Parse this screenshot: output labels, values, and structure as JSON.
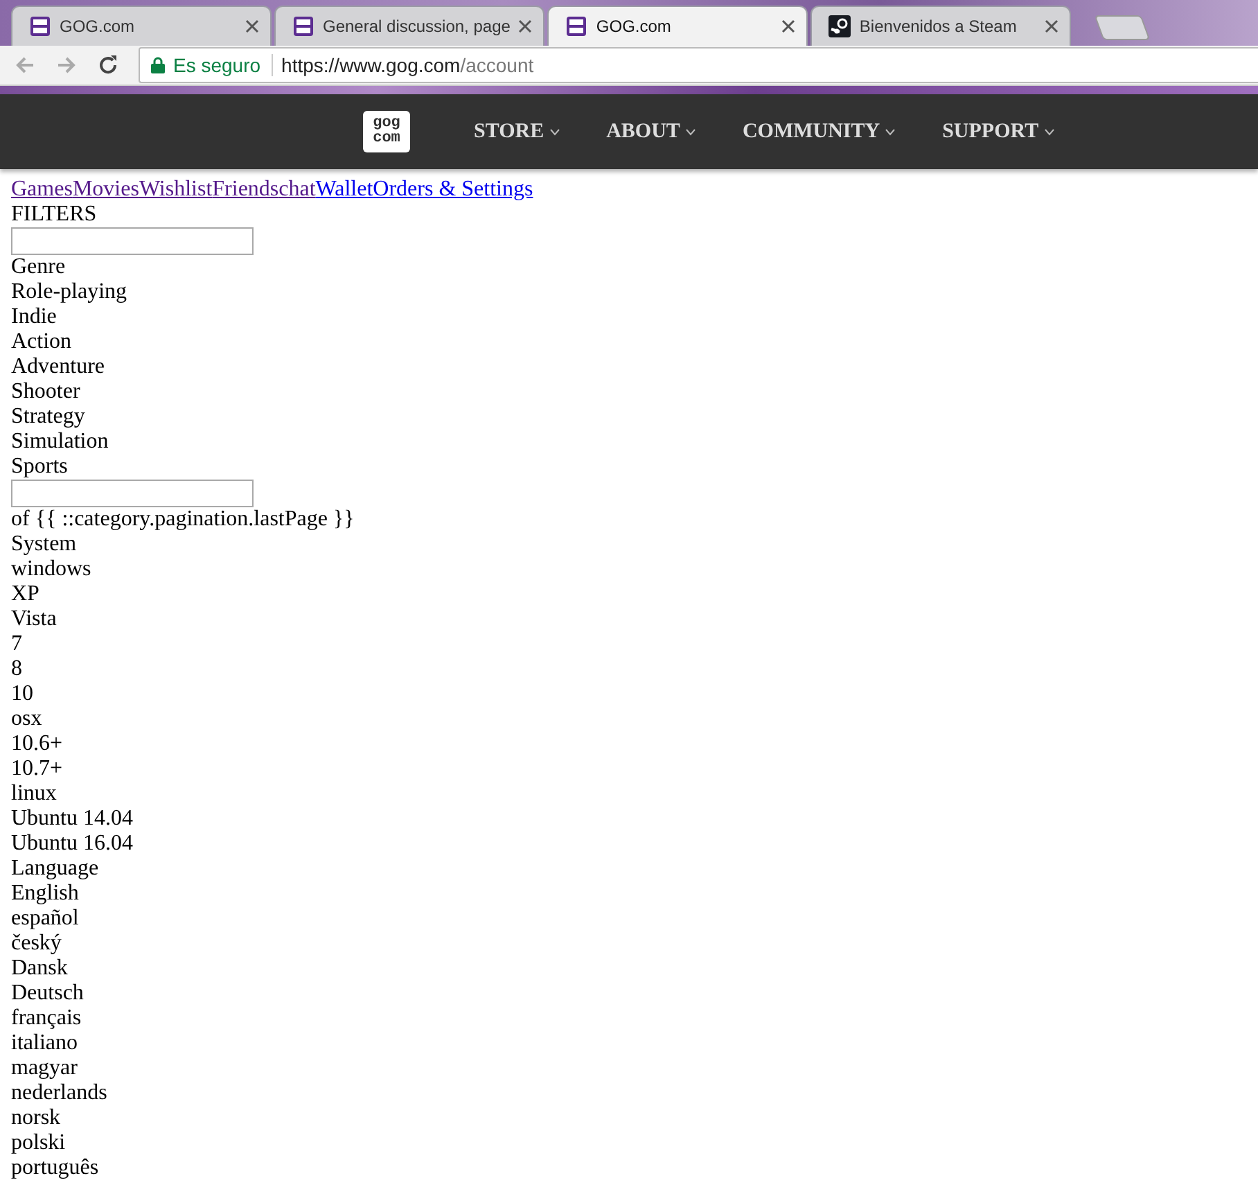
{
  "browser_tabs": [
    {
      "title": "GOG.com",
      "kind": "gog",
      "selected": false
    },
    {
      "title": "General discussion, page",
      "kind": "gog",
      "selected": false
    },
    {
      "title": "GOG.com",
      "kind": "gog",
      "selected": true
    },
    {
      "title": "Bienvenidos a Steam",
      "kind": "steam",
      "selected": false
    }
  ],
  "address_bar": {
    "security": "Es seguro",
    "url_host": "https://www.gog.com",
    "url_path": "/account"
  },
  "site_nav": {
    "logo": [
      "gog",
      "com"
    ],
    "items": [
      "STORE",
      "ABOUT",
      "COMMUNITY",
      "SUPPORT"
    ]
  },
  "account_links": [
    {
      "label": "Games",
      "visited": true
    },
    {
      "label": "Movies",
      "visited": true
    },
    {
      "label": "Wishlist",
      "visited": true
    },
    {
      "label": "Friends",
      "visited": true
    },
    {
      "label": "chat",
      "visited": true
    },
    {
      "label": "Wallet",
      "visited": false
    },
    {
      "label": "Orders & Settings",
      "visited": false
    }
  ],
  "content": [
    {
      "kind": "text",
      "text": "FILTERS"
    },
    {
      "kind": "input"
    },
    {
      "kind": "text",
      "text": "Genre"
    },
    {
      "kind": "text",
      "text": "Role-playing"
    },
    {
      "kind": "text",
      "text": "Indie"
    },
    {
      "kind": "text",
      "text": "Action"
    },
    {
      "kind": "text",
      "text": "Adventure"
    },
    {
      "kind": "text",
      "text": "Shooter"
    },
    {
      "kind": "text",
      "text": "Strategy"
    },
    {
      "kind": "text",
      "text": "Simulation"
    },
    {
      "kind": "text",
      "text": "Sports"
    },
    {
      "kind": "input"
    },
    {
      "kind": "text",
      "text": "of {{ ::category.pagination.lastPage }}"
    },
    {
      "kind": "text",
      "text": "System"
    },
    {
      "kind": "text",
      "text": "windows"
    },
    {
      "kind": "text",
      "text": "XP"
    },
    {
      "kind": "text",
      "text": "Vista"
    },
    {
      "kind": "text",
      "text": "7"
    },
    {
      "kind": "text",
      "text": "8"
    },
    {
      "kind": "text",
      "text": "10"
    },
    {
      "kind": "text",
      "text": "osx"
    },
    {
      "kind": "text",
      "text": "10.6+"
    },
    {
      "kind": "text",
      "text": "10.7+"
    },
    {
      "kind": "text",
      "text": "linux"
    },
    {
      "kind": "text",
      "text": "Ubuntu 14.04"
    },
    {
      "kind": "text",
      "text": "Ubuntu 16.04"
    },
    {
      "kind": "text",
      "text": "Language"
    },
    {
      "kind": "text",
      "text": "English"
    },
    {
      "kind": "text",
      "text": "español"
    },
    {
      "kind": "text",
      "text": "český"
    },
    {
      "kind": "text",
      "text": "Dansk"
    },
    {
      "kind": "text",
      "text": "Deutsch"
    },
    {
      "kind": "text",
      "text": "français"
    },
    {
      "kind": "text",
      "text": "italiano"
    },
    {
      "kind": "text",
      "text": "magyar"
    },
    {
      "kind": "text",
      "text": "nederlands"
    },
    {
      "kind": "text",
      "text": "norsk"
    },
    {
      "kind": "text",
      "text": "polski"
    },
    {
      "kind": "text",
      "text": "português"
    }
  ]
}
